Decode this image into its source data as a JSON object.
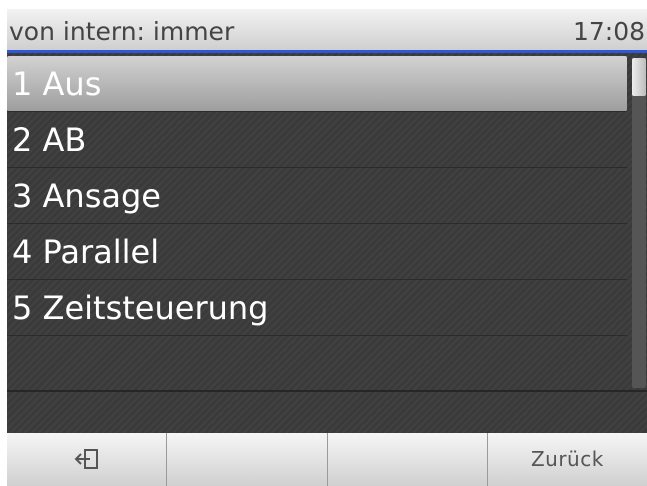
{
  "header": {
    "title": "von intern:  immer",
    "time": "17:08"
  },
  "menu": {
    "items": [
      {
        "label": "1 Aus",
        "selected": true
      },
      {
        "label": "2 AB",
        "selected": false
      },
      {
        "label": "3 Ansage",
        "selected": false
      },
      {
        "label": "4 Parallel",
        "selected": false
      },
      {
        "label": "5 Zeitsteuerung",
        "selected": false
      }
    ]
  },
  "softkeys": [
    {
      "icon": "exit-icon",
      "label": ""
    },
    {
      "label": ""
    },
    {
      "label": ""
    },
    {
      "label": "Zurück"
    }
  ],
  "colors": {
    "accent": "#2f57d9",
    "list_bg": "#3a3a3a"
  }
}
